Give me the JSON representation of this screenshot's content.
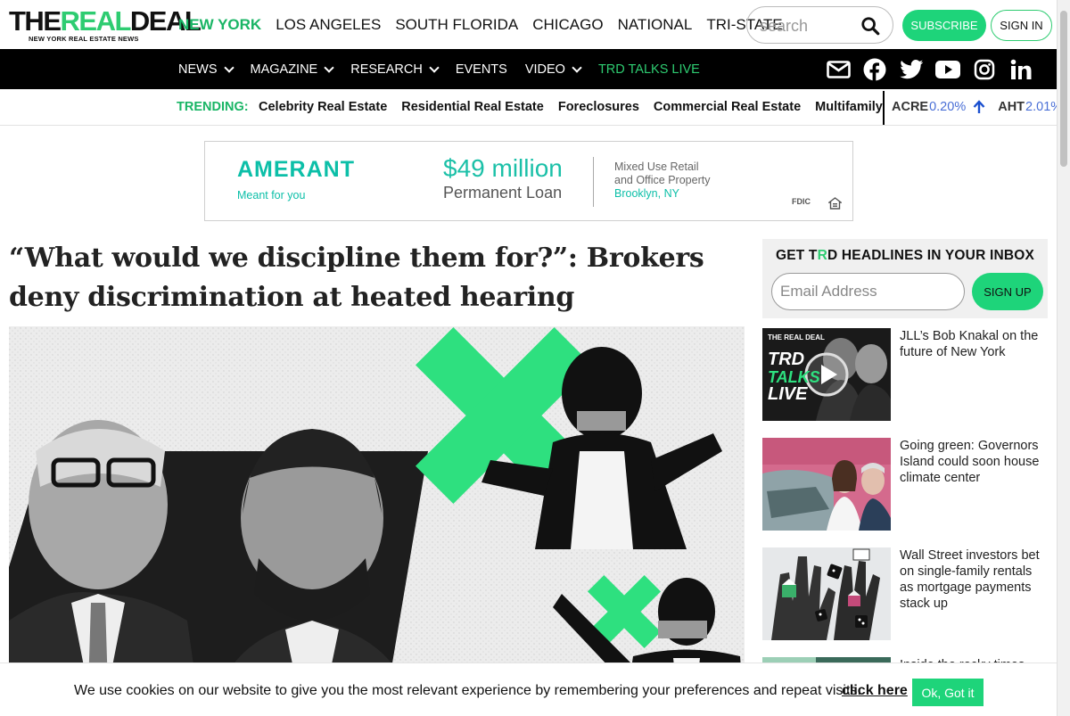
{
  "brand": {
    "logo_main_a": "THE",
    "logo_main_b": "REAL",
    "logo_main_c": "DEAL",
    "logo_sub": "NEW YORK REAL ESTATE NEWS"
  },
  "regions": [
    "NEW YORK",
    "LOS ANGELES",
    "SOUTH FLORIDA",
    "CHICAGO",
    "NATIONAL",
    "TRI-STATE"
  ],
  "search": {
    "placeholder": "search"
  },
  "header_buttons": {
    "subscribe": "SUBSCRIBE",
    "signin": "SIGN IN"
  },
  "nav": [
    {
      "label": "NEWS",
      "dropdown": true
    },
    {
      "label": "MAGAZINE",
      "dropdown": true
    },
    {
      "label": "RESEARCH",
      "dropdown": true
    },
    {
      "label": "EVENTS",
      "dropdown": false
    },
    {
      "label": "VIDEO",
      "dropdown": true
    },
    {
      "label": "TRD TALKS LIVE",
      "dropdown": false
    }
  ],
  "social_icons": [
    "mail-icon",
    "facebook-icon",
    "twitter-icon",
    "youtube-icon",
    "instagram-icon",
    "linkedin-icon"
  ],
  "trending": {
    "label": "TRENDING:",
    "items": [
      "Celebrity Real Estate",
      "Residential Real Estate",
      "Foreclosures",
      "Commercial Real Estate",
      "Multifamily"
    ]
  },
  "tickers": [
    {
      "symbol": "ACRE",
      "change": "0.20%"
    },
    {
      "symbol": "AHT",
      "change": "2.01%"
    }
  ],
  "ad": {
    "brand": "AMERANT",
    "tagline": "Meant for you",
    "amount": "$49 million",
    "loan_type": "Permanent Loan",
    "property_line1": "Mixed Use Retail",
    "property_line2": "and Office Property",
    "location": "Brooklyn, NY",
    "fdic": "FDIC"
  },
  "article": {
    "headline": "“What would we discipline them for?”: Brokers deny discrimination at heated hearing"
  },
  "newsletter": {
    "title_a": "GET T",
    "title_r": "R",
    "title_b": "D HEADLINES IN YOUR INBOX",
    "email_placeholder": "Email Address",
    "signup": "SIGN UP"
  },
  "sidebar_stories": [
    {
      "title": "JLL’s Bob Knakal on the future of New York",
      "thumb_text": [
        "TRD",
        "TALKS",
        "LIVE"
      ],
      "thumb_brand": "THE REAL DEAL"
    },
    {
      "title": "Going green: Governors Island could soon house climate center"
    },
    {
      "title": "Wall Street investors bet on single-family rentals as mortgage payments stack up"
    },
    {
      "title": "Inside the rocky times"
    }
  ],
  "cookie": {
    "text": "We use cookies on our website to give you the most relevant experience by remembering your preferences and repeat visits.",
    "link": "click here",
    "button": "Ok, Got it"
  },
  "colors": {
    "accent": "#1ed47a",
    "nav_bg": "#000000",
    "ticker": "#4a6fd6",
    "ad_teal": "#0cbfa8"
  }
}
